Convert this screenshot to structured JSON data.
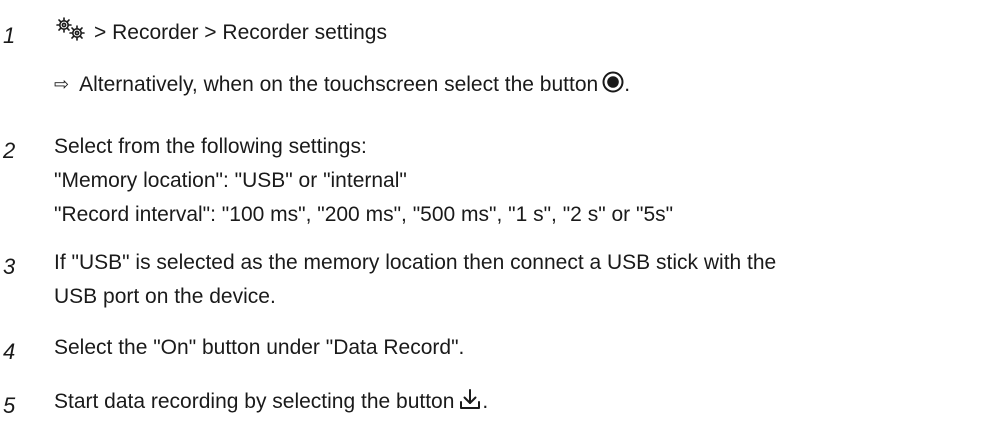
{
  "steps": [
    {
      "number": "1",
      "text": "> Recorder > Recorder settings",
      "result_arrow": "⇨",
      "result_text": "Alternatively, when on the touchscreen select the button",
      "result_end": "."
    },
    {
      "number": "2",
      "lines": [
        "Select from the following settings:",
        "\"Memory location\": \"USB\" or \"internal\"",
        "\"Record interval\": \"100 ms\", \"200 ms\", \"500 ms\", \"1 s\", \"2 s\" or \"5s\""
      ]
    },
    {
      "number": "3",
      "lines": [
        "If \"USB\" is selected as the memory location then connect a USB stick with the",
        "USB port on the device."
      ]
    },
    {
      "number": "4",
      "text": "Select the \"On\" button under \"Data Record\"."
    },
    {
      "number": "5",
      "text": "Start data recording by selecting the button",
      "text_end": "."
    }
  ],
  "icons": {
    "settings": "gears-icon",
    "record": "record-button-icon",
    "download": "download-icon"
  }
}
